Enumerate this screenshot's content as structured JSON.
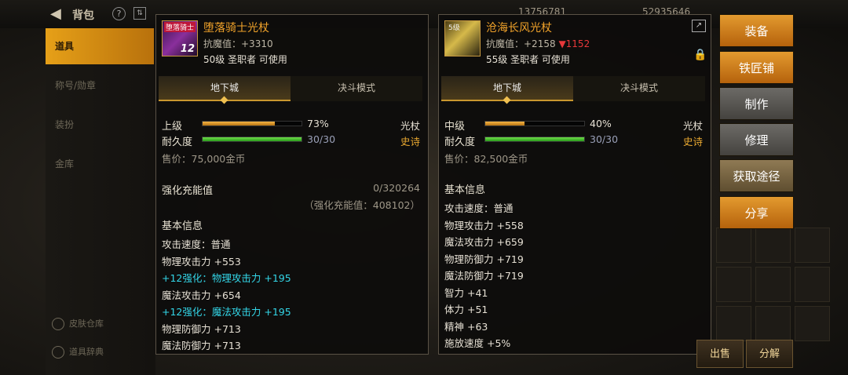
{
  "topbar": {
    "title": "背包",
    "help": "?",
    "currency1": "13756781",
    "currency2": "52935646"
  },
  "sidebar": {
    "items": [
      "道具",
      "称号/勋章",
      "装扮",
      "金库"
    ],
    "bottom": [
      "皮肤仓库",
      "道具辞典"
    ]
  },
  "left": {
    "icon_tag": "堕落骑士",
    "icon_level": "12",
    "name": "堕落骑士光杖",
    "resist": "抗魔值：+3310",
    "req": "50级 圣职者 可使用",
    "tabs": [
      "地下城",
      "决斗模式"
    ],
    "grade_label": "上级",
    "grade_pct": "73%",
    "grade_value": 0.73,
    "dur_label": "耐久度",
    "dur_text": "30/30",
    "dur_value": 1.0,
    "type": "光杖",
    "rarity": "史诗",
    "price": "售价：75,000金币",
    "charge_label": "强化充能值",
    "charge_value": "0/320264",
    "charge_sub": "（强化充能值：408102）",
    "basic_title": "基本信息",
    "stats": [
      {
        "text": "攻击速度：普通",
        "cls": ""
      },
      {
        "text": "物理攻击力 +553",
        "cls": ""
      },
      {
        "text": "+12强化：物理攻击力 +195",
        "cls": "cyan"
      },
      {
        "text": "魔法攻击力 +654",
        "cls": ""
      },
      {
        "text": "+12强化：魔法攻击力 +195",
        "cls": "cyan"
      },
      {
        "text": "物理防御力 +713",
        "cls": ""
      },
      {
        "text": "魔法防御力 +713",
        "cls": ""
      }
    ]
  },
  "right": {
    "icon_tag": "5级",
    "name": "沧海长风光杖",
    "resist": "抗魔值：+2158",
    "resist_down": "▼1152",
    "req": "55级 圣职者 可使用",
    "tabs": [
      "地下城",
      "决斗模式"
    ],
    "grade_label": "中级",
    "grade_pct": "40%",
    "grade_value": 0.4,
    "dur_label": "耐久度",
    "dur_text": "30/30",
    "dur_value": 1.0,
    "type": "光杖",
    "rarity": "史诗",
    "price": "售价：82,500金币",
    "basic_title": "基本信息",
    "stats": [
      "攻击速度：普通",
      "物理攻击力 +558",
      "魔法攻击力 +659",
      "物理防御力 +719",
      "魔法防御力 +719",
      "智力 +41",
      "体力 +51",
      "精神 +63",
      "施放速度 +5%"
    ]
  },
  "actions": [
    "装备",
    "铁匠铺",
    "制作",
    "修理",
    "获取途径",
    "分享"
  ],
  "bottom": {
    "sell": "出售",
    "disassemble": "分解"
  },
  "icons": {
    "back": "arrow-left-icon",
    "lock": "lock-icon",
    "share": "share-icon"
  }
}
